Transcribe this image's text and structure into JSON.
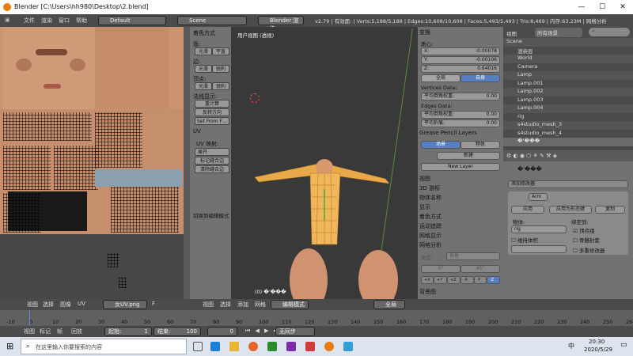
{
  "window": {
    "title": "Blender [C:\\Users\\hh980\\Desktop\\2.blend]",
    "minimize": "—",
    "maximize": "☐",
    "close": "✕"
  },
  "infobar": {
    "menus": [
      "文件",
      "渲染",
      "窗口",
      "帮助"
    ],
    "screen": "Default",
    "scene": "Scene",
    "engine": "Blender 渲染",
    "stats": "v2.79 | 有效面: | Verts:5,188/5,188 | Edges:10,608/10,608 | Faces:5,493/5,493 | Tris:8,469 | 内存:63.23M | 网格分析"
  },
  "toolshelf": {
    "shading_header": "着色方式",
    "face_label": "面:",
    "smooth": "光滑",
    "flat": "平直",
    "edge_label": "边:",
    "smooth2": "光滑",
    "sharp": "锐利",
    "vertex_label": "顶点:",
    "smooth3": "光滑",
    "sharp2": "锐利",
    "normals_label": "法线显示:",
    "recalc": "重计算",
    "flip": "反转方向",
    "setfrom": "Set From F…",
    "uv_header": "UV",
    "uv_map": "UV 映射:",
    "unwrap": "展开",
    "mark_seam": "标记缝合边",
    "clear_seam": "清除缝合边",
    "toggle": "切换到编辑模式"
  },
  "viewport": {
    "label": "用户视图 (透视)",
    "object": "(0) �'���"
  },
  "props3d": {
    "transform": "变换",
    "median": "质心:",
    "x": "X:",
    "xv": "-0.00078",
    "y": "Y:",
    "yv": "-0.00106",
    "z": "Z:",
    "zv": "0.64016",
    "global": "全局",
    "local": "自身",
    "vdata": "Vertices Data:",
    "mean_bw": "平均倒角权重:",
    "mean_bw_v": "0.00",
    "edata": "Edges Data:",
    "mean_bw2": "平均倒角权重:",
    "mean_bw2_v": "0.00",
    "mean_crease": "平均折痕:",
    "mean_crease_v": "0.00",
    "gp": "Grease Pencil Layers",
    "scene_tab": "场景",
    "obj_tab": "物体",
    "new": "新建",
    "new_layer": "New Layer",
    "sections": [
      "视图",
      "3D 游标",
      "物体名称",
      "显示",
      "着色方式",
      "运动追踪",
      "网格显示",
      "网格分析"
    ],
    "type_label": "类型:",
    "type_val": "悬垂",
    "min": "0°",
    "max": "45°",
    "axes": [
      "+X",
      "+Y",
      "+Z",
      "-X",
      "-Y",
      "-Z"
    ],
    "bg": "背景图"
  },
  "outliner": {
    "view": "视图",
    "search": "搜索",
    "filter": "所有场景",
    "rows": [
      "Scene",
      "渲染层",
      "World",
      "Camera",
      "Lamp",
      "Lamp.001",
      "Lamp.002",
      "Lamp.003",
      "Lamp.004",
      "rig",
      "s4studio_mesh_3",
      "s4studio_mesh_4",
      "�'���"
    ]
  },
  "propedit": {
    "obj": "�'���",
    "add_mod": "添加修改器",
    "arm": "Arm",
    "apply": "应用",
    "apply_shape": "应用为形态键",
    "copy": "复制",
    "object_lbl": "物体:",
    "bind_lbl": "绑定到:",
    "rig": "rig",
    "vgroup": "顶点组",
    "keep_vol": "维持体积",
    "bone_env": "骨骼封套",
    "multi": "多重修改器"
  },
  "uvbar": {
    "menus": [
      "视图",
      "选择",
      "图像",
      "UV"
    ],
    "image": "女UV.png",
    "f": "F"
  },
  "vpbar": {
    "menus": [
      "视图",
      "选择",
      "添加",
      "网格"
    ],
    "mode": "编辑模式",
    "pivot": "全局"
  },
  "timeline": {
    "ticks": [
      "-10",
      "0",
      "10",
      "20",
      "30",
      "40",
      "50",
      "60",
      "70",
      "80",
      "90",
      "100",
      "110",
      "120",
      "130",
      "140",
      "150",
      "160",
      "170",
      "180",
      "190",
      "200",
      "210",
      "220",
      "230",
      "240",
      "250",
      "260"
    ]
  },
  "tlctl": {
    "menus": [
      "视图",
      "标记",
      "帧",
      "回放"
    ],
    "start": "起始:",
    "start_v": "1",
    "end": "结束:",
    "end_v": "100",
    "cur": "0",
    "sync": "无同步"
  },
  "taskbar": {
    "search": "在这里输入你要搜索的内容",
    "time": "20:30",
    "date": "2020/5/29",
    "lang": "中"
  }
}
